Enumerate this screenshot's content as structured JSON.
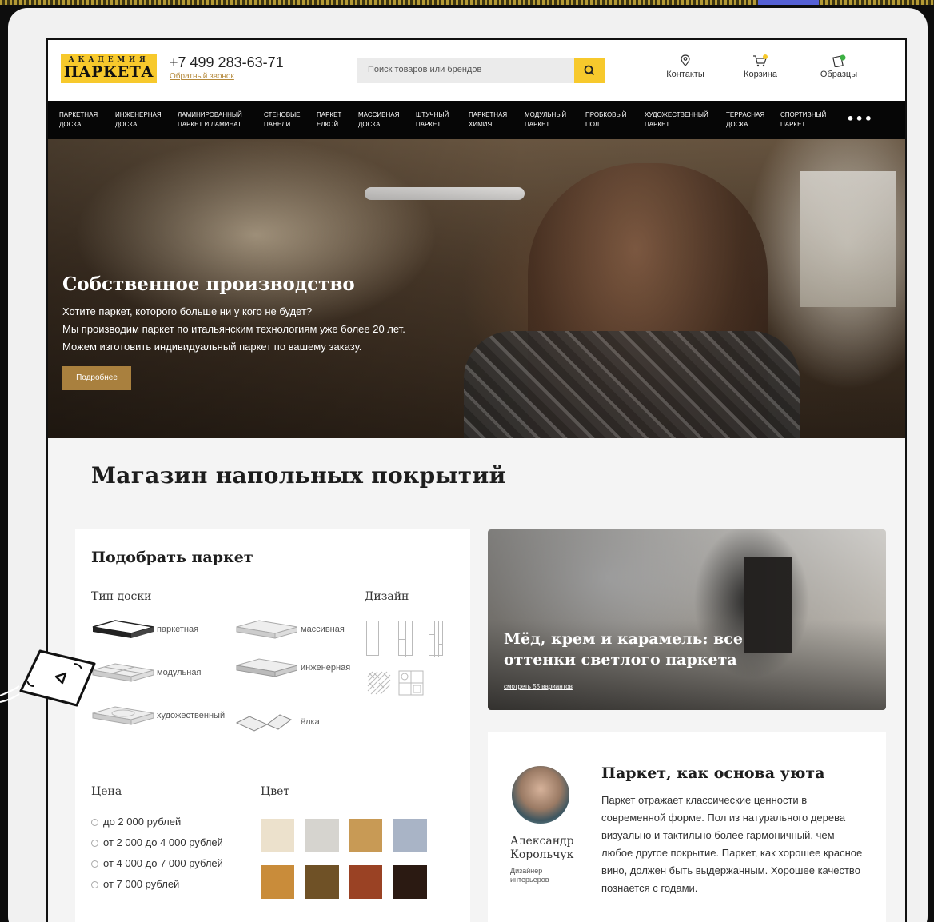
{
  "header": {
    "logo_top": "АКАДЕМИЯ",
    "logo_main": "ПАРКЕТА",
    "phone": "+7 499 283-63-71",
    "callback": "Обратный звонок",
    "search_placeholder": "Поиск товаров или брендов",
    "contacts": "Контакты",
    "cart": "Корзина",
    "samples": "Образцы"
  },
  "nav": {
    "items": [
      "паркетная доска",
      "инженерная доска",
      "ламинированный паркет и ламинат",
      "стеновые панели",
      "паркет елкой",
      "массивная доска",
      "штучный паркет",
      "паркетная химия",
      "модульный паркет",
      "пробковый пол",
      "художественный паркет",
      "террасная доска",
      "спортивный паркет"
    ],
    "more": "•••"
  },
  "hero": {
    "title": "Собственное производство",
    "line1": "Хотите паркет, которого больше ни у кого не будет?",
    "line2": "Мы производим паркет по итальянским технологиям уже более 20 лет.",
    "line3": "Можем изготовить индивидуальный паркет по вашему заказу.",
    "button": "Подробнее"
  },
  "main": {
    "title": "Магазин напольных покрытий"
  },
  "picker": {
    "title": "Подобрать паркет",
    "board_type": "Тип доски",
    "design": "Дизайн",
    "boards": [
      "паркетная",
      "массивная",
      "модульная",
      "инженерная",
      "художественный",
      "ёлка"
    ],
    "price_title": "Цена",
    "color_title": "Цвет",
    "prices": [
      "до 2 000 рублей",
      "от 2 000 до 4 000 рублей",
      "от 4 000 до 7 000 рублей",
      "от 7 000 рублей"
    ],
    "colors": [
      "#ece1cc",
      "#d6d4cf",
      "#c89a55",
      "#a9b4c6",
      "#c98c3a",
      "#6f5126",
      "#9a4224",
      "#2b1a12"
    ]
  },
  "feature": {
    "title": "Мёд, крем и карамель: все оттенки светлого паркета",
    "link": "смотреть 55 вариантов"
  },
  "quote": {
    "name": "Александр Корольчук",
    "role": "Дизайнер интерьеров",
    "title": "Паркет, как основа уюта",
    "text": "Паркет отражает классические ценности в современной форме. Пол из натурального дерева визуально и тактильно более гармоничный, чем любое другое покрытие. Паркет, как хорошее красное вино, должен быть выдержанным. Хорошее качество познается с годами."
  },
  "colors": {
    "accent": "#f7c92c",
    "button": "#a9803e",
    "nav_bg": "#060606"
  }
}
